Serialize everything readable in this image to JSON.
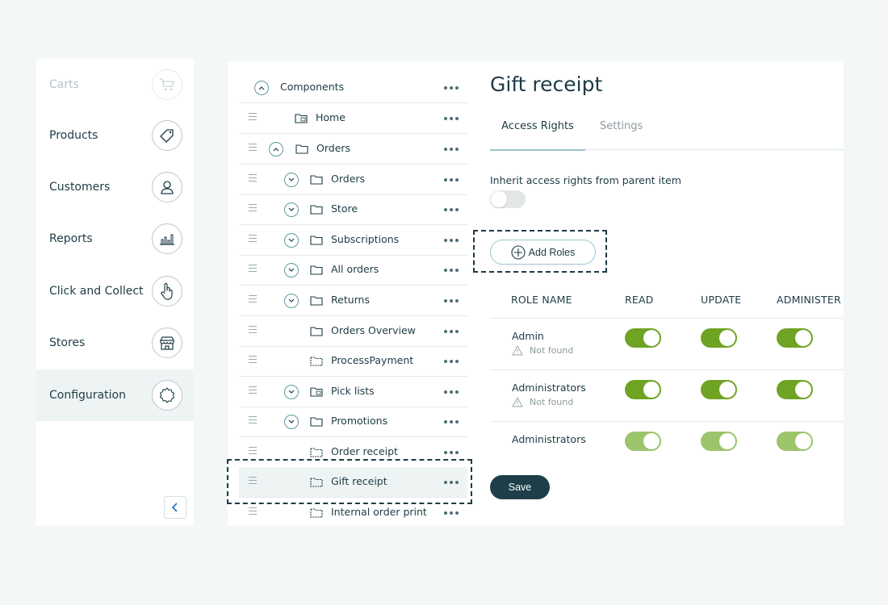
{
  "sidebar": {
    "items": [
      {
        "label": "Carts",
        "icon": "cart-icon",
        "state": "faded"
      },
      {
        "label": "Products",
        "icon": "tag-icon"
      },
      {
        "label": "Customers",
        "icon": "user-icon"
      },
      {
        "label": "Reports",
        "icon": "bar-chart-icon"
      },
      {
        "label": "Click and Collect",
        "icon": "hand-pointer-icon"
      },
      {
        "label": "Stores",
        "icon": "store-icon"
      },
      {
        "label": "Configuration",
        "icon": "gear-icon",
        "state": "active"
      }
    ],
    "collapse_icon": "chevron-left-icon"
  },
  "tree": {
    "items": [
      {
        "label": "Components"
      },
      {
        "label": "Home"
      },
      {
        "label": "Orders"
      },
      {
        "label": "Orders"
      },
      {
        "label": "Store"
      },
      {
        "label": "Subscriptions"
      },
      {
        "label": "All orders"
      },
      {
        "label": "Returns"
      },
      {
        "label": "Orders Overview"
      },
      {
        "label": "ProcessPayment"
      },
      {
        "label": "Pick lists"
      },
      {
        "label": "Promotions"
      },
      {
        "label": "Order receipt"
      },
      {
        "label": "Gift receipt",
        "selected": true
      },
      {
        "label": "Internal order print"
      }
    ]
  },
  "detail": {
    "title": "Gift receipt",
    "tabs": [
      {
        "label": "Access Rights",
        "active": true
      },
      {
        "label": "Settings"
      }
    ],
    "inherit_label": "Inherit access rights from parent item",
    "inherit_enabled": false,
    "add_roles_label": "Add Roles",
    "table": {
      "headers": [
        "ROLE NAME",
        "READ",
        "UPDATE",
        "ADMINISTER"
      ],
      "rows": [
        {
          "name": "Admin",
          "status": "Not found",
          "read": true,
          "update": true,
          "administer": true
        },
        {
          "name": "Administrators",
          "status": "Not found",
          "read": true,
          "update": true,
          "administer": true
        },
        {
          "name": "Administrators",
          "status": "",
          "read": true,
          "update": true,
          "administer": true
        }
      ]
    },
    "save_label": "Save"
  },
  "colors": {
    "accent": "#1e3f4a",
    "toggle_on": "#6fa323",
    "toggle_on_light": "#9bc46b",
    "selection": "#eef4f4"
  }
}
